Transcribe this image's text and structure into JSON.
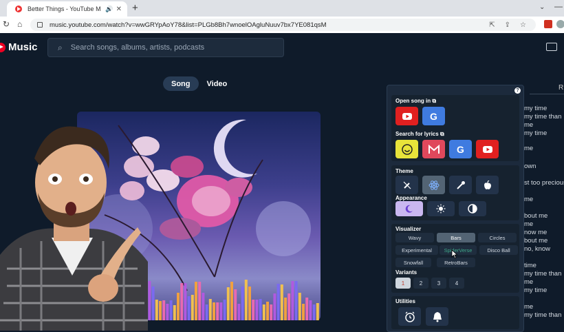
{
  "browser": {
    "tab_title": "Better Things - YouTube M",
    "url": "music.youtube.com/watch?v=wwGRYpAoY78&list=PLGb8Bh7wnoelOAgluNuuv7bx7YE081qsM"
  },
  "ytmusic": {
    "logo_text": "Music",
    "search_placeholder": "Search songs, albums, artists, podcasts",
    "toggle": {
      "song": "Song",
      "video": "Video",
      "active": "Song"
    }
  },
  "panel": {
    "open_song_in": "Open song in",
    "search_for_lyrics": "Search for lyrics",
    "theme": "Theme",
    "appearance": "Appearance",
    "visualizer": "Visualizer",
    "visualizer_options": [
      "Wavy",
      "Bars",
      "Circles",
      "Experimental",
      "SpiderVerse",
      "Disco Ball",
      "Snowfall",
      "RetroBars"
    ],
    "visualizer_selected": "Bars",
    "variants": "Variants",
    "variant_options": [
      "1",
      "2",
      "3",
      "4"
    ],
    "variant_selected": "1",
    "utilities": "Utilities",
    "google_letter": "G",
    "help": "?"
  },
  "right_tab_label": "R",
  "lyrics_partial": [
    "my time",
    "my time than",
    "me",
    "my time",
    "me",
    "own",
    "st too precious",
    "me",
    "bout me",
    "me",
    "now me",
    "bout me",
    "no, know",
    "time",
    "my time than",
    "me",
    "my time",
    "me",
    "my time than"
  ],
  "colors": {
    "youtube_red": "#e02020",
    "google_blue": "#3f7be0",
    "lyrics_yellow": "#e8e33a",
    "genius_pink": "#e0485c",
    "selected_bg": "#536474",
    "appearance_purple": "#c9b7f0"
  }
}
